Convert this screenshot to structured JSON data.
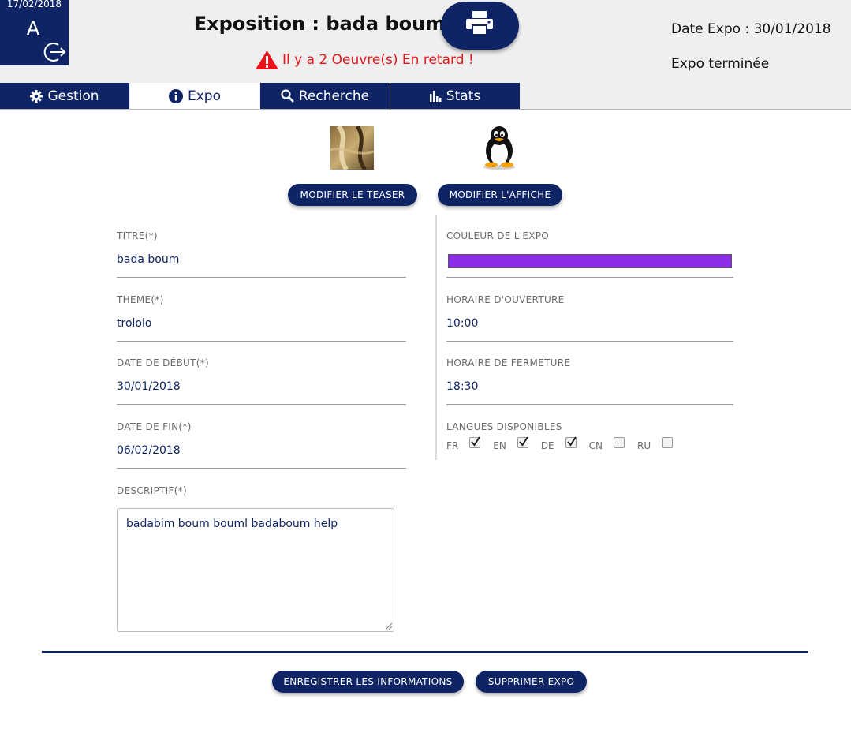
{
  "header": {
    "user_date": "17/02/2018",
    "user_initial": "A",
    "title": "Exposition : bada boum",
    "warning": "Il y a 2 Oeuvre(s) En retard !",
    "date_expo": "Date Expo : 30/01/2018",
    "status": "Expo terminée"
  },
  "tabs": [
    {
      "label": "Gestion",
      "icon": "gear-icon"
    },
    {
      "label": "Expo",
      "icon": "info-icon"
    },
    {
      "label": "Recherche",
      "icon": "search-icon"
    },
    {
      "label": "Stats",
      "icon": "stats-icon"
    }
  ],
  "active_tab": "Expo",
  "media": {
    "teaser_button": "MODIFIER LE TEASER",
    "affiche_button": "MODIFIER L'AFFICHE"
  },
  "form": {
    "titre": {
      "label": "TITRE(*)",
      "value": "bada boum"
    },
    "theme": {
      "label": "THEME(*)",
      "value": "trololo"
    },
    "date_debut": {
      "label": "DATE DE DÉBUT(*)",
      "value": "30/01/2018"
    },
    "date_fin": {
      "label": "DATE DE FIN(*)",
      "value": "06/02/2018"
    },
    "descriptif": {
      "label": "DESCRIPTIF(*)",
      "value": "badabim boum bouml badaboum help"
    },
    "couleur": {
      "label": "COULEUR DE L'EXPO",
      "color": "#8c2ee8"
    },
    "ouverture": {
      "label": "HORAIRE D'OUVERTURE",
      "value": "10:00"
    },
    "fermeture": {
      "label": "HORAIRE DE FERMETURE",
      "value": "18:30"
    },
    "langues": {
      "label": "LANGUES DISPONIBLES",
      "items": [
        {
          "code": "FR",
          "checked": true
        },
        {
          "code": "EN",
          "checked": true
        },
        {
          "code": "DE",
          "checked": true
        },
        {
          "code": "CN",
          "checked": false
        },
        {
          "code": "RU",
          "checked": false
        }
      ]
    }
  },
  "actions": {
    "save": "ENREGISTRER LES INFORMATIONS",
    "delete": "SUPPRIMER EXPO"
  },
  "colors": {
    "primary": "#0f2464",
    "warning": "#e8141a",
    "expo_color": "#8c2ee8"
  }
}
